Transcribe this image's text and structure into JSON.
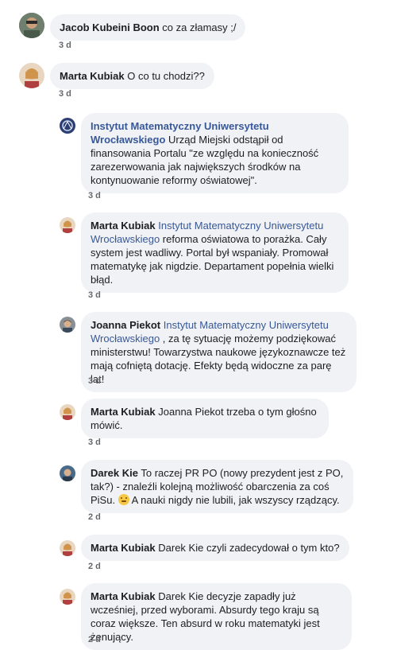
{
  "comments": [
    {
      "author": "Jacob Kubeini Boon",
      "mention": "",
      "text": " co za złamasy ;/",
      "time": "3 d"
    },
    {
      "author": "Marta Kubiak",
      "mention": "",
      "text": " O co tu chodzi??",
      "time": "3 d"
    },
    {
      "author": "Instytut Matematyczny Uniwersytetu Wrocławskiego",
      "mention": "",
      "text": " Urząd Miejski odstąpił od finansowania Portalu \"ze względu na konieczność zarezerwowania jak największych środków na kontynuowanie reformy oświatowej\".",
      "time": "3 d"
    },
    {
      "author": "Marta Kubiak",
      "mention": "Instytut Matematyczny Uniwersytetu Wrocławskiego",
      "text": " reforma oświatowa to porażka. Cały system jest wadliwy. Portal był wspaniały. Promował matematykę jak nigdzie. Departament popełnia wielki błąd.",
      "time": "3 d"
    },
    {
      "author": "Joanna Piekot",
      "mention": "Instytut Matematyczny Uniwersytetu Wrocławskiego",
      "text": " , za tę sytuację możemy podziękować ministerstwu! Towarzystwa naukowe językoznawcze też mają cofniętą dotację. Efekty będą widoczne za parę lat!",
      "time": "3 d"
    },
    {
      "author": "Marta Kubiak",
      "mention": "",
      "text": " Joanna Piekot trzeba o tym głośno mówić.",
      "time": "3 d"
    },
    {
      "author": "Darek Kie",
      "mention": "",
      "text": " To raczej PR PO (nowy prezydent jest z PO, tak?) - znaleźli kolejną możliwość obarczenia za coś PiSu.",
      "text_after": " A nauki nigdy nie lubili, jak wszyscy rządzący.",
      "time": "2 d"
    },
    {
      "author": "Marta Kubiak",
      "mention": "",
      "text": " Darek Kie czyli zadecydował o tym kto?",
      "time": "2 d"
    },
    {
      "author": "Marta Kubiak",
      "mention": "",
      "text": " Darek Kie decyzje zapadły już wcześniej, przed wyborami. Absurdy tego kraju są coraz większe. Ten absurd w roku matematyki jest żenujący.",
      "time": "2 d"
    }
  ],
  "colors": {
    "bubble": "#f0f2f5",
    "link": "#385898",
    "time": "#65676b"
  }
}
